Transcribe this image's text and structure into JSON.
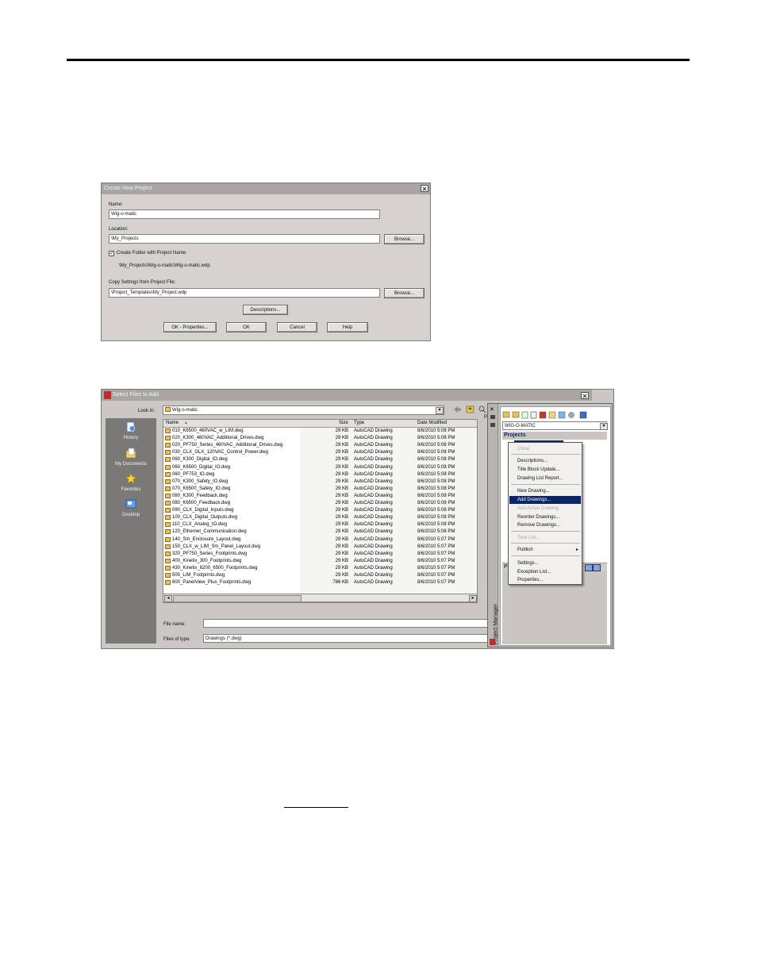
{
  "create_dialog": {
    "title": "Create New Project",
    "close_glyph": "✕",
    "name_label": "Name:",
    "name_value": "Wig-o-matic",
    "location_label": "Location:",
    "location_value": "\\My_Projects",
    "browse_label": "Browse...",
    "create_folder_label": "Create Folder with Project Name",
    "create_folder_checked": "✓",
    "path_preview": "\\My_Projects\\Wig-o-matic\\Wig-o-matic.wdp",
    "copy_settings_label": "Copy Settings from Project File:",
    "copy_settings_value": "\\Project_Templates\\My_Project.wdp",
    "browse2_label": "Browse...",
    "descriptions_label": "Descriptions...",
    "ok_properties_label": "OK - Properties...",
    "ok_label": "OK",
    "cancel_label": "Cancel",
    "help_label": "Help"
  },
  "select_dialog": {
    "title": "Select Files to Add",
    "close_glyph": "✕",
    "look_in_label": "Look in:",
    "look_in_value": "Wig-o-matic",
    "places": [
      "History",
      "My Documents",
      "Favorites",
      "Desktop"
    ],
    "columns": {
      "name": "Name",
      "sort": "▲",
      "size": "Size",
      "type": "Type",
      "date": "Date Modified"
    },
    "files": [
      {
        "name": "010_K6500_460VAC_w_LIM.dwg",
        "size": "29 KB",
        "type": "AutoCAD Drawing",
        "date": "8/6/2010 5:08 PM"
      },
      {
        "name": "020_K300_460VAC_Additional_Drives.dwg",
        "size": "29 KB",
        "type": "AutoCAD Drawing",
        "date": "8/6/2010 5:08 PM"
      },
      {
        "name": "020_PF750_Series_460VAC_Additional_Drives.dwg",
        "size": "29 KB",
        "type": "AutoCAD Drawing",
        "date": "8/6/2010 5:08 PM"
      },
      {
        "name": "030_CLX_GLX_120VAC_Control_Power.dwg",
        "size": "29 KB",
        "type": "AutoCAD Drawing",
        "date": "8/6/2010 5:08 PM"
      },
      {
        "name": "060_K300_Digital_IO.dwg",
        "size": "29 KB",
        "type": "AutoCAD Drawing",
        "date": "8/6/2010 5:08 PM"
      },
      {
        "name": "060_K6500_Digital_IO.dwg",
        "size": "29 KB",
        "type": "AutoCAD Drawing",
        "date": "8/6/2010 5:08 PM"
      },
      {
        "name": "060_PF753_IO.dwg",
        "size": "29 KB",
        "type": "AutoCAD Drawing",
        "date": "8/6/2010 5:08 PM"
      },
      {
        "name": "070_K300_Safety_IO.dwg",
        "size": "29 KB",
        "type": "AutoCAD Drawing",
        "date": "8/6/2010 5:08 PM"
      },
      {
        "name": "070_K6500_Safety_IO.dwg",
        "size": "29 KB",
        "type": "AutoCAD Drawing",
        "date": "8/6/2010 5:08 PM"
      },
      {
        "name": "080_K300_Feedback.dwg",
        "size": "29 KB",
        "type": "AutoCAD Drawing",
        "date": "8/6/2010 5:08 PM"
      },
      {
        "name": "080_K6500_Feedback.dwg",
        "size": "29 KB",
        "type": "AutoCAD Drawing",
        "date": "8/6/2010 5:08 PM"
      },
      {
        "name": "090_CLX_Digital_Inputs.dwg",
        "size": "29 KB",
        "type": "AutoCAD Drawing",
        "date": "8/6/2010 5:08 PM"
      },
      {
        "name": "100_CLX_Digital_Outputs.dwg",
        "size": "29 KB",
        "type": "AutoCAD Drawing",
        "date": "8/6/2010 5:08 PM"
      },
      {
        "name": "110_CLX_Analog_IO.dwg",
        "size": "29 KB",
        "type": "AutoCAD Drawing",
        "date": "8/6/2010 5:08 PM"
      },
      {
        "name": "120_Ethernet_Communication.dwg",
        "size": "29 KB",
        "type": "AutoCAD Drawing",
        "date": "8/6/2010 5:08 PM"
      },
      {
        "name": "140_Sm_Enclosure_Layout.dwg",
        "size": "29 KB",
        "type": "AutoCAD Drawing",
        "date": "8/6/2010 5:07 PM"
      },
      {
        "name": "150_CLX_w_LIM_Sm_Panel_Layout.dwg",
        "size": "29 KB",
        "type": "AutoCAD Drawing",
        "date": "8/6/2010 5:07 PM"
      },
      {
        "name": "320_PF750_Series_Footprints.dwg",
        "size": "29 KB",
        "type": "AutoCAD Drawing",
        "date": "8/6/2010 5:07 PM"
      },
      {
        "name": "400_Kinetix_300_Footprints.dwg",
        "size": "29 KB",
        "type": "AutoCAD Drawing",
        "date": "8/6/2010 5:07 PM"
      },
      {
        "name": "430_Kinetix_6200_6500_Footprints.dwg",
        "size": "29 KB",
        "type": "AutoCAD Drawing",
        "date": "8/6/2010 5:07 PM"
      },
      {
        "name": "500_LIM_Footprints.dwg",
        "size": "29 KB",
        "type": "AutoCAD Drawing",
        "date": "8/6/2010 5:07 PM"
      },
      {
        "name": "600_PanelView_Plus_Footprints.dwg",
        "size": "786 KB",
        "type": "AutoCAD Drawing",
        "date": "8/6/2010 5:07 PM"
      }
    ],
    "file_name_label": "File name:",
    "file_name_value": "",
    "files_of_type_label": "Files of type:",
    "files_of_type_value": "Drawings (*.dwg)",
    "preview_label": "P"
  },
  "project_manager": {
    "vertical_title": "Project Manager",
    "project_dropdown": "WIG-O-MATIC",
    "projects_header": "Projects",
    "lower_label": "P",
    "menu": [
      {
        "label": "Close",
        "state": "disabled"
      },
      {
        "label": "Descriptions...",
        "state": "normal"
      },
      {
        "label": "Title Block Update...",
        "state": "normal"
      },
      {
        "label": "Drawing List Report...",
        "state": "normal"
      },
      {
        "label": "New Drawing...",
        "state": "normal"
      },
      {
        "label": "Add Drawings...",
        "state": "selected"
      },
      {
        "label": "Add Active Drawing",
        "state": "disabled"
      },
      {
        "label": "Reorder Drawings...",
        "state": "normal"
      },
      {
        "label": "Remove Drawings...",
        "state": "normal"
      },
      {
        "label": "Task List...",
        "state": "disabled"
      },
      {
        "label": "Publish",
        "state": "normal"
      },
      {
        "label": "Settings...",
        "state": "normal"
      },
      {
        "label": "Exception List...",
        "state": "normal"
      },
      {
        "label": "Properties...",
        "state": "normal"
      }
    ],
    "submenu_arrow": "▸"
  },
  "colors": {
    "selection": "#0a246a",
    "dialog_bg": "#d6d3ce",
    "title_bar": "#a9a6a2"
  }
}
